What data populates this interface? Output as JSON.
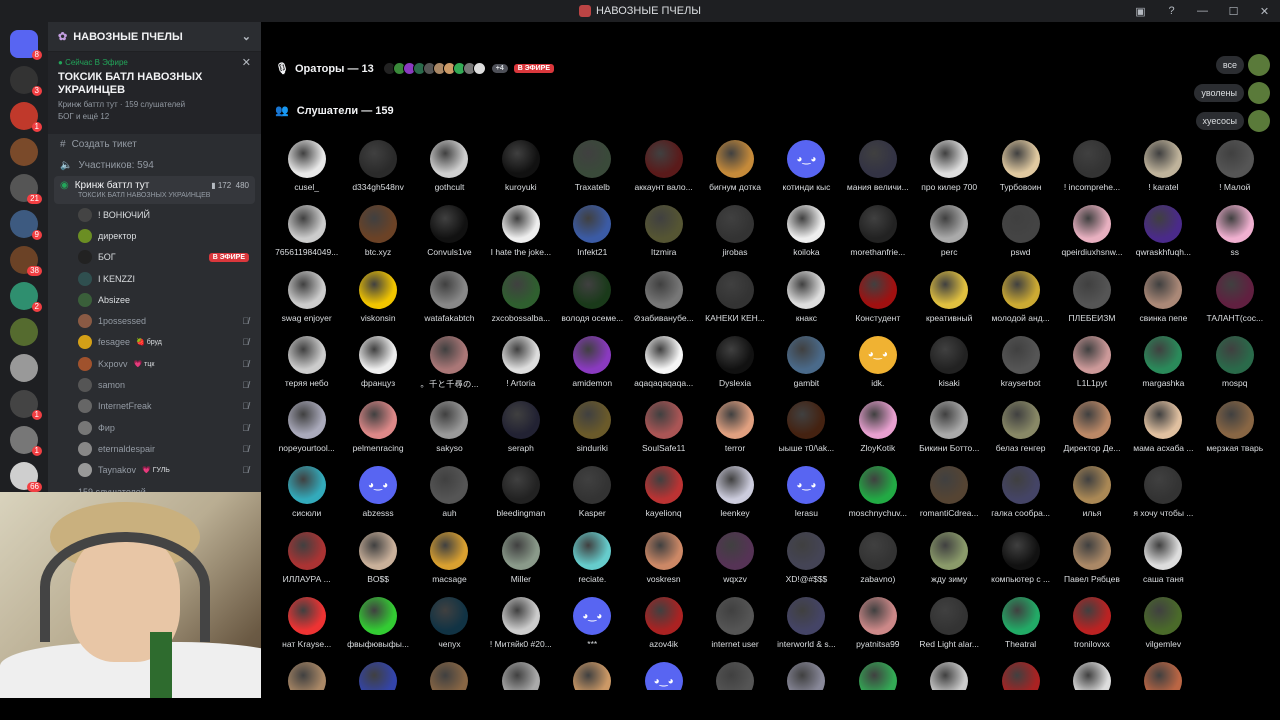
{
  "window": {
    "title": "НАВОЗНЫЕ ПЧЕЛЫ"
  },
  "server": {
    "name": "НАВОЗНЫЕ ПЧЕЛЫ",
    "badges": [
      "8",
      "3",
      "1",
      "",
      "21",
      "9",
      "38",
      "2",
      "",
      "",
      "1",
      "1",
      "66",
      "29",
      "1"
    ],
    "colors": [
      "#5865f2",
      "#333",
      "#c0392b",
      "#7a4a2a",
      "#555",
      "#3d5a80",
      "#6b4226",
      "#2f8f6f",
      "#556b2f",
      "#999",
      "#444",
      "#777",
      "#cfcfcf",
      "#2bb5c8",
      "#222",
      "#8e44ad"
    ]
  },
  "stage": {
    "now_live": "Сейчас В Эфире",
    "title": "ТОКСИК БАТЛ НАВОЗНЫХ УКРАИНЦЕВ",
    "sub": "Кринж баттл тут · 159 слушателей",
    "host": "БОГ и ещё 12"
  },
  "channels": {
    "create_ticket": "Создать тикет",
    "participants": "Участников: 594",
    "voice_name": "Кринж баттл тут",
    "voice_sub": "ТОКСИК БАТЛ НАВОЗНЫХ УКРАИНЦЕВ",
    "voice_count1": "172",
    "voice_count2": "480",
    "more_listeners": "159 слушателей",
    "members": [
      {
        "name": "! ВОНЮЧИЙ",
        "color": "#444",
        "live": false,
        "tag": ""
      },
      {
        "name": "директор",
        "color": "#6b8e23",
        "live": false,
        "tag": ""
      },
      {
        "name": "БОГ",
        "color": "#222",
        "live": true,
        "tag": ""
      },
      {
        "name": "I KENZZI",
        "color": "#2f4f4f",
        "live": false,
        "tag": ""
      },
      {
        "name": "Absizee",
        "color": "#3a5f3a",
        "live": false,
        "tag": ""
      },
      {
        "name": "1possessed",
        "color": "#8a5a44",
        "live": false,
        "tag": ""
      },
      {
        "name": "fesagee",
        "color": "#d4a017",
        "live": false,
        "tag": "🍓 бруд"
      },
      {
        "name": "Kxpovv",
        "color": "#a0522d",
        "live": false,
        "tag": "💗 тцк"
      },
      {
        "name": "samon",
        "color": "#555",
        "live": false,
        "tag": ""
      },
      {
        "name": "InternetFreak",
        "color": "#666",
        "live": false,
        "tag": ""
      },
      {
        "name": "Фир",
        "color": "#777",
        "live": false,
        "tag": ""
      },
      {
        "name": "eternaldespair",
        "color": "#888",
        "live": false,
        "tag": ""
      },
      {
        "name": "Taynakov",
        "color": "#999",
        "live": false,
        "tag": "💗 ГУЛЬ"
      }
    ],
    "live_label": "В ЭФИРЕ"
  },
  "main": {
    "speakers_label": "Ораторы — 13",
    "speakers_more": "+4",
    "live_label": "В ЭФИРЕ",
    "listeners_label": "Слушатели — 159",
    "filters": [
      "все",
      "уволены",
      "хуесосы"
    ]
  },
  "listeners": [
    {
      "n": "cusel_",
      "c": "#e8e8e8"
    },
    {
      "n": "d334gh548nv",
      "c": "#2a2a2a"
    },
    {
      "n": "gothcult",
      "c": "#cfcfcf"
    },
    {
      "n": "kuroyuki",
      "c": "#111"
    },
    {
      "n": "Traxatelb",
      "c": "#3a4a3a"
    },
    {
      "n": "аккаунт вало...",
      "c": "#5a1a1a"
    },
    {
      "n": "бигнум дотка",
      "c": "#c58a3a"
    },
    {
      "n": "котинди кыс",
      "c": "discord"
    },
    {
      "n": "мания величи...",
      "c": "#334"
    },
    {
      "n": "про килер 700",
      "c": "#ddd"
    },
    {
      "n": "Турбовоин",
      "c": "#e0c9a0"
    },
    {
      "n": "! incomprehe...",
      "c": "#333"
    },
    {
      "n": "! karatel",
      "c": "#bfb39b"
    },
    {
      "n": "! Малой",
      "c": "#555"
    },
    {
      "n": "765611984049...",
      "c": "#ccc"
    },
    {
      "n": "btc.xyz",
      "c": "#6b4226"
    },
    {
      "n": "Convuls1ve",
      "c": "#111"
    },
    {
      "n": "I hate the joke...",
      "c": "#eee"
    },
    {
      "n": "Infekt21",
      "c": "#3b5ba5"
    },
    {
      "n": "Itzmira",
      "c": "#553"
    },
    {
      "n": "jirobas",
      "c": "#333"
    },
    {
      "n": "koiloka",
      "c": "#eee"
    },
    {
      "n": "morethanfrie...",
      "c": "#222"
    },
    {
      "n": "perc",
      "c": "#aaa"
    },
    {
      "n": "pswd",
      "c": "#444"
    },
    {
      "n": "qpeirdiuxhsnw...",
      "c": "#e8b0c0"
    },
    {
      "n": "qwraskhfuqh...",
      "c": "#4a2a8a"
    },
    {
      "n": "ss",
      "c": "#f0b0d0"
    },
    {
      "n": "swag enjoyer",
      "c": "#ccc"
    },
    {
      "n": "viskonsin",
      "c": "#f2c500"
    },
    {
      "n": "watafakabtch",
      "c": "#888"
    },
    {
      "n": "zxcobossalba...",
      "c": "#2f5f2f"
    },
    {
      "n": "володя осеме...",
      "c": "#1a3a1a"
    },
    {
      "n": "⊘забиванубе...",
      "c": "#777"
    },
    {
      "n": "КАНЕКИ КЕН...",
      "c": "#333"
    },
    {
      "n": "кнакс",
      "c": "#ddd"
    },
    {
      "n": "Констудент",
      "c": "#a01010"
    },
    {
      "n": "креативный",
      "c": "#e0c040"
    },
    {
      "n": "молодой анд...",
      "c": "#ccaa33"
    },
    {
      "n": "ПЛЕБЕИЗМ",
      "c": "#555"
    },
    {
      "n": "свинка пепе",
      "c": "#a87"
    },
    {
      "n": "ТАЛАНТ(сос...",
      "c": "#602040"
    },
    {
      "n": "теряя небо",
      "c": "#ccc"
    },
    {
      "n": "француз",
      "c": "#eee"
    },
    {
      "n": "。千と千尋の...",
      "c": "#a77"
    },
    {
      "n": "! Artoria",
      "c": "#ddd"
    },
    {
      "n": "amidemon",
      "c": "#8a3ac0"
    },
    {
      "n": "aqaqaqaqaqa...",
      "c": "#f5f5f5"
    },
    {
      "n": "Dyslexia",
      "c": "#111"
    },
    {
      "n": "gambit",
      "c": "#4a6a8a"
    },
    {
      "n": "idk.",
      "c": "discord2"
    },
    {
      "n": "kisaki",
      "c": "#222"
    },
    {
      "n": "krayserbot",
      "c": "#555"
    },
    {
      "n": "L1L1pyt",
      "c": "#c99"
    },
    {
      "n": "margashka",
      "c": "#2a8a5a"
    },
    {
      "n": "mospq",
      "c": "#2a6a4a"
    },
    {
      "n": "nopeyourtool...",
      "c": "#aab"
    },
    {
      "n": "pelmenracing",
      "c": "#d88"
    },
    {
      "n": "sakyso",
      "c": "#999"
    },
    {
      "n": "seraph",
      "c": "#223"
    },
    {
      "n": "sinduriki",
      "c": "#6a5a2a"
    },
    {
      "n": "SoulSafe11",
      "c": "#a55"
    },
    {
      "n": "terror",
      "c": "#e0a080"
    },
    {
      "n": "ыыше т0/\\ak...",
      "c": "#421"
    },
    {
      "n": "ZloyKotik",
      "c": "#e8a0d0"
    },
    {
      "n": "Бикини Ботто...",
      "c": "#aaa"
    },
    {
      "n": "белаз генгер",
      "c": "#886"
    },
    {
      "n": "Директор Де...",
      "c": "#b86"
    },
    {
      "n": "мама асхаба ...",
      "c": "#e0c0a0"
    },
    {
      "n": "мерзкая тварь",
      "c": "#864"
    },
    {
      "n": "сисюли",
      "c": "#3ab"
    },
    {
      "n": "abzesss",
      "c": "discord"
    },
    {
      "n": "auh",
      "c": "#555"
    },
    {
      "n": "bleedingman",
      "c": "#222"
    },
    {
      "n": "Kasper",
      "c": "#333"
    },
    {
      "n": "kayelionq",
      "c": "#b33"
    },
    {
      "n": "leenkey",
      "c": "#ccd"
    },
    {
      "n": "lerasu",
      "c": "discord"
    },
    {
      "n": "moschnychuv...",
      "c": "#2a4"
    },
    {
      "n": "romantiCdrea...",
      "c": "#543"
    },
    {
      "n": "галка сообра...",
      "c": "#446"
    },
    {
      "n": "илья",
      "c": "#a85"
    },
    {
      "n": "я хочу чтобы ...",
      "c": "#333"
    },
    {
      "n": "",
      "c": "#000"
    },
    {
      "n": "ИЛЛАУРА ...",
      "c": "#a33"
    },
    {
      "n": "BO$$",
      "c": "#c9b09a"
    },
    {
      "n": "macsage",
      "c": "#d9a030"
    },
    {
      "n": "Miller",
      "c": "#8a9a8a"
    },
    {
      "n": "reciate.",
      "c": "#6cc"
    },
    {
      "n": "voskresn",
      "c": "#c86"
    },
    {
      "n": "wqxzv",
      "c": "#535"
    },
    {
      "n": "XD!@#$$$",
      "c": "#445"
    },
    {
      "n": "zabavno)",
      "c": "#333"
    },
    {
      "n": "жду зиму",
      "c": "#8a9a6a"
    },
    {
      "n": "компьютер с ...",
      "c": "#111"
    },
    {
      "n": "Павел Рябцев",
      "c": "#a86"
    },
    {
      "n": "саша таня",
      "c": "#ddd"
    },
    {
      "n": "",
      "c": "#000"
    },
    {
      "n": "нат Krayse...",
      "c": "#e33"
    },
    {
      "n": "фвыфювыфы...",
      "c": "#3c3"
    },
    {
      "n": "чепух",
      "c": "#134"
    },
    {
      "n": "! Митяйк0 #20...",
      "c": "#ccc"
    },
    {
      "n": "***",
      "c": "discord"
    },
    {
      "n": "azov4ik",
      "c": "#a22"
    },
    {
      "n": "internet user",
      "c": "#555"
    },
    {
      "n": "interworld & s...",
      "c": "#446"
    },
    {
      "n": "pyatnitsa99",
      "c": "#c88"
    },
    {
      "n": "Red Light alar...",
      "c": "#333"
    },
    {
      "n": "Theatral",
      "c": "#2a6"
    },
    {
      "n": "tronilovxx",
      "c": "#b22"
    },
    {
      "n": "vilgemlev",
      "c": "#4a6a2a"
    },
    {
      "n": "",
      "c": "#000"
    },
    {
      "n": "",
      "c": "#a86"
    },
    {
      "n": "",
      "c": "#34a"
    },
    {
      "n": "",
      "c": "#864"
    },
    {
      "n": "",
      "c": "#aaa"
    },
    {
      "n": "",
      "c": "#c96"
    },
    {
      "n": "",
      "c": "discord"
    },
    {
      "n": "",
      "c": "#555"
    },
    {
      "n": "",
      "c": "#889"
    },
    {
      "n": "",
      "c": "#3a5"
    },
    {
      "n": "",
      "c": "#ccc"
    },
    {
      "n": "",
      "c": "#a22"
    },
    {
      "n": "",
      "c": "#ddd"
    },
    {
      "n": "",
      "c": "#b64"
    },
    {
      "n": "",
      "c": "#000"
    }
  ],
  "speaker_colors": [
    "#222",
    "#3a8a3a",
    "#8a3ac0",
    "#2a6a4a",
    "#555",
    "#a86",
    "#c96",
    "#3a5",
    "#777",
    "#ddd"
  ]
}
